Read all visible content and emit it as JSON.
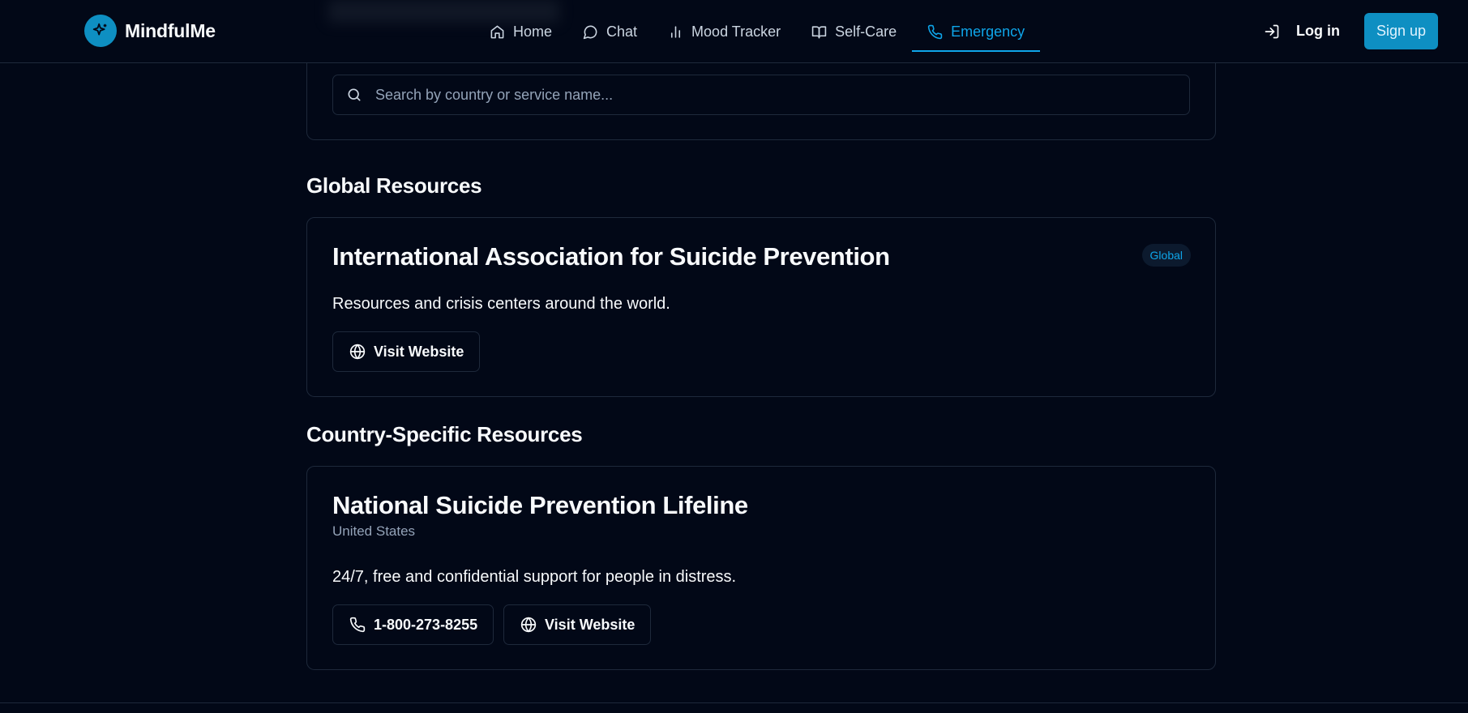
{
  "app": {
    "name": "MindfulMe"
  },
  "nav": {
    "items": [
      {
        "label": "Home",
        "icon": "home-icon"
      },
      {
        "label": "Chat",
        "icon": "chat-icon"
      },
      {
        "label": "Mood Tracker",
        "icon": "bar-chart-icon"
      },
      {
        "label": "Self-Care",
        "icon": "book-open-icon"
      },
      {
        "label": "Emergency",
        "icon": "phone-icon",
        "active": true
      }
    ]
  },
  "auth": {
    "login_label": "Log in",
    "signup_label": "Sign up"
  },
  "search": {
    "placeholder": "Search by country or service name..."
  },
  "global": {
    "heading": "Global Resources",
    "resources": [
      {
        "title": "International Association for Suicide Prevention",
        "badge": "Global",
        "description": "Resources and crisis centers around the world.",
        "website_label": "Visit Website"
      }
    ]
  },
  "country": {
    "heading": "Country-Specific Resources",
    "resources": [
      {
        "title": "National Suicide Prevention Lifeline",
        "country": "United States",
        "description": "24/7, free and confidential support for people in distress.",
        "phone_label": "1-800-273-8255",
        "website_label": "Visit Website"
      }
    ]
  },
  "colors": {
    "background": "#020817",
    "accent": "#0ea5e9",
    "brand": "#0e8fc2",
    "border": "#1e293b",
    "muted_text": "#94a3b8"
  }
}
